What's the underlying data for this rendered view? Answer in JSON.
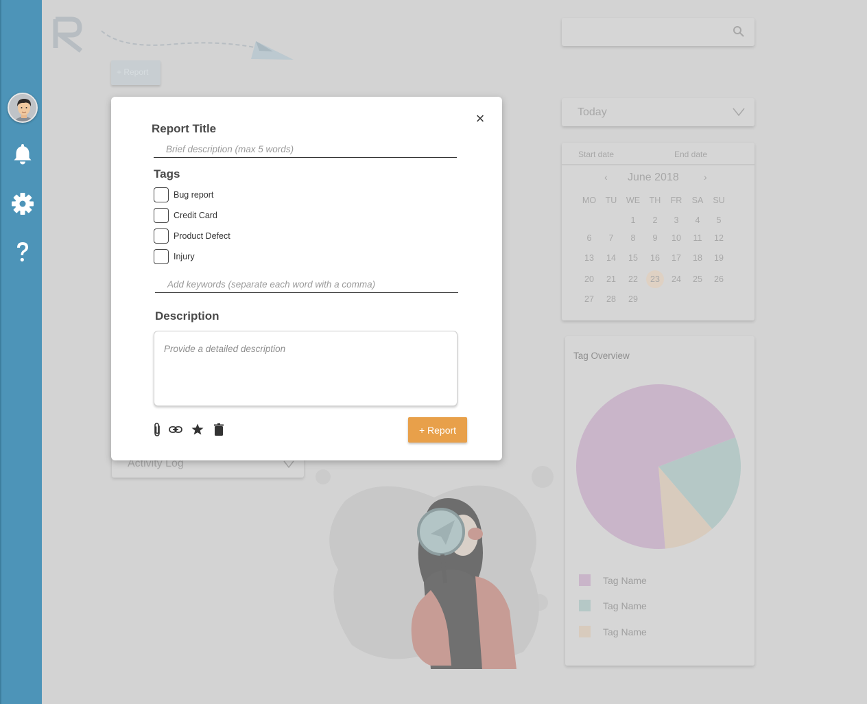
{
  "sidebar": {
    "icons": [
      "avatar",
      "bell-icon",
      "gear-icon",
      "help-icon"
    ],
    "color": "#4d94b8"
  },
  "header": {
    "search_placeholder": ""
  },
  "filters": {
    "period": "Today",
    "start_label": "Start date",
    "end_label": "End date"
  },
  "calendar": {
    "month": "June 2018",
    "prev": "‹",
    "next": "›",
    "weekdays": [
      "MO",
      "TU",
      "WE",
      "TH",
      "FR",
      "SA",
      "SU"
    ],
    "weeks": [
      [
        "",
        "",
        "1",
        "2",
        "3",
        "4",
        "5"
      ],
      [
        "6",
        "7",
        "8",
        "9",
        "10",
        "11",
        "12"
      ],
      [
        "13",
        "14",
        "15",
        "16",
        "17",
        "18",
        "19"
      ],
      [
        "20",
        "21",
        "22",
        "23",
        "24",
        "25",
        "26"
      ],
      [
        "27",
        "28",
        "29",
        "",
        "",
        "",
        ""
      ]
    ],
    "selected_day": "23",
    "selected_color": "#dfd1c3"
  },
  "tag_overview": {
    "title": "Tag Overview",
    "legend": [
      {
        "label": "Tag Name",
        "color": "#c9b5c9"
      },
      {
        "label": "Tag Name",
        "color": "#b5c8c6"
      },
      {
        "label": "Tag Name",
        "color": "#d8cbbd"
      }
    ]
  },
  "chart_data": {
    "type": "pie",
    "title": "Tag Overview",
    "slices": [
      {
        "label": "Tag Name",
        "value": 70.5,
        "color": "#c9b5c9"
      },
      {
        "label": "Tag Name",
        "value": 19.5,
        "color": "#b5c8c6"
      },
      {
        "label": "Tag Name",
        "value": 10,
        "color": "#d8cbbd"
      }
    ]
  },
  "activity_log": {
    "label": "Activity Log"
  },
  "background_button": {
    "label": "+ Report"
  },
  "modal": {
    "close": "×",
    "title_heading": "Report Title",
    "title_placeholder": "Brief description (max 5 words)",
    "tags_heading": "Tags",
    "tags": [
      "Bug report",
      "Credit Card",
      "Product Defect",
      "Injury"
    ],
    "keywords_placeholder": "Add keywords (separate each word with a comma)",
    "description_heading": "Description",
    "description_placeholder": "Provide a detailed description",
    "toolbar": [
      "paperclip-icon",
      "link-icon",
      "star-icon",
      "trash-icon"
    ],
    "submit_label": "+ Report",
    "submit_color": "#e8a04a"
  }
}
